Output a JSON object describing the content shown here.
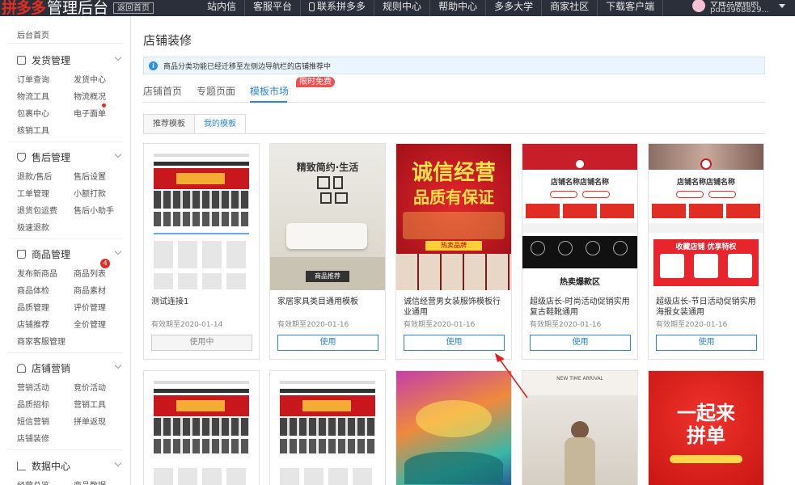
{
  "topbar": {
    "brand_red": "拼多多",
    "brand_rest": "管理后台",
    "home_button": "返回首页",
    "nav": [
      "站内信",
      "客服平台",
      "联系拼多多",
      "规则中心",
      "帮助中心",
      "多多大学",
      "商家社区",
      "下载客户端"
    ],
    "username_top": "文胖品牌师的",
    "username": "pdd3968829..."
  },
  "sidebar": {
    "top_link": "后台首页",
    "sections": [
      {
        "title": "发货管理",
        "items": [
          "订单查询",
          "发货中心",
          "物流工具",
          "物流概况",
          "包裹中心",
          "电子面单",
          "核销工具"
        ]
      },
      {
        "title": "售后管理",
        "items": [
          "退款/售后",
          "售后设置",
          "工单管理",
          "小额打款",
          "退货包运费",
          "售后小助手",
          "极速退款"
        ]
      },
      {
        "title": "商品管理",
        "items": [
          "发布新商品",
          "商品列表",
          "商品体检",
          "商品素材",
          "品质管理",
          "评价管理",
          "店铺推荐",
          "全价管理",
          "商家客服管理"
        ]
      },
      {
        "title": "店铺营销",
        "items": [
          "营销活动",
          "竞价活动",
          "品质招标",
          "营销工具",
          "短信营销",
          "拼单返现",
          "店铺装修"
        ]
      },
      {
        "title": "数据中心",
        "items": [
          "经营总览",
          "商品数据"
        ]
      }
    ],
    "badge_count": "4"
  },
  "main": {
    "page_title": "店铺装修",
    "notice": "商品分类功能已经迁移至左侧边导航栏的店铺推荐中",
    "tabs": [
      "店铺首页",
      "专题页面",
      "模板市场"
    ],
    "free_badge": "限时免费",
    "subtabs": [
      "推荐模板",
      "我的模板"
    ],
    "cards": [
      {
        "name": "测试连接1",
        "date": "有效期至2020-01-14",
        "button": "使用中"
      },
      {
        "name": "家居家具类目通用模板",
        "date": "有效期至2020-01-16",
        "button": "使用"
      },
      {
        "name": "诚信经营男女装服饰模板行业通用",
        "date": "有效期至2020-01-16",
        "button": "使用"
      },
      {
        "name": "超级店长-时尚活动促销实用复古鞋靴通用",
        "date": "有效期至2020-01-16",
        "button": "使用"
      },
      {
        "name": "超级店长-节日活动促销实用海报女装通用",
        "date": "有效期至2020-01-16",
        "button": "使用"
      }
    ],
    "thumbs": {
      "furniture_title": "精致简约·生活",
      "furniture_tag": "商品推荐",
      "credit_slogan_1": "诚信经营",
      "credit_slogan_2": "品质有保证",
      "credit_tag": "热卖品牌",
      "shop_name": "店铺名称店铺名称",
      "hot_section": "热卖爆款区",
      "coupon_section": "收藏店铺 优享特权",
      "new_arrival": "NEW TIME ARRIVAL",
      "together_1": "一起来",
      "together_2": "拼单"
    }
  },
  "colors": {
    "accent": "#2d86da",
    "brand_red": "#e02e24",
    "topbar": "#2b2f3a",
    "notice_bg": "#eaf5fd"
  }
}
